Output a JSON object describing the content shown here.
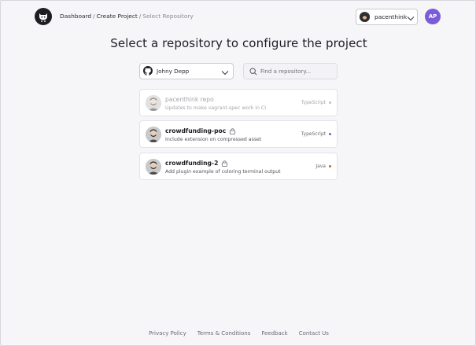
{
  "breadcrumb": {
    "items": [
      "Dashboard",
      "Create Project"
    ],
    "current": "Select Repository"
  },
  "header": {
    "user": {
      "name": "pacenthink"
    },
    "account_initials": "AP"
  },
  "page_title": "Select a repository to configure the project",
  "owner_select": {
    "value": "Johny Depp"
  },
  "search": {
    "placeholder": "Find a repository..."
  },
  "repositories": [
    {
      "name": "pacenthink repo",
      "description": "Updates to make vagrant-spec work in CI",
      "language": "TypeScript",
      "lang_color": "#c4b8d8",
      "private": false,
      "disabled": true
    },
    {
      "name": "crowdfunding-poc",
      "description": "Include extension on compressed asset",
      "language": "TypeScript",
      "lang_color": "#7a5bd1",
      "private": true,
      "disabled": false
    },
    {
      "name": "crowdfunding-2",
      "description": "Add plugin example of coloring terminal output",
      "language": "Java",
      "lang_color": "#c0623a",
      "private": true,
      "disabled": false
    }
  ],
  "footer": {
    "links": [
      "Privacy Policy",
      "Terms & Conditions",
      "Feedback",
      "Contact Us"
    ]
  },
  "icons": {
    "logo": "github-cat-logo-icon",
    "owner": "github-icon",
    "search": "search-icon",
    "chevron": "chevron-down-icon",
    "lock": "lock-icon"
  },
  "colors": {
    "accent": "#7b5bd6",
    "background": "#f6f6f9"
  }
}
